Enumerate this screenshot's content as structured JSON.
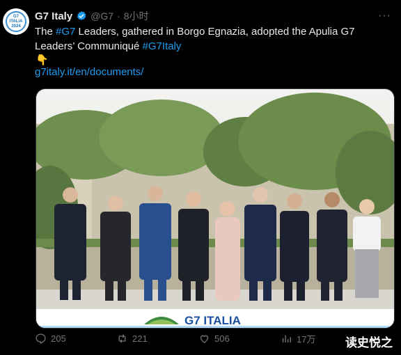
{
  "tweet": {
    "author_name": "G7 Italy",
    "handle": "@G7",
    "separator": "·",
    "time": "8小时",
    "avatar_text": "G7 ITALIA 2024",
    "text_prefix": "The ",
    "hashtag_1": "#G7",
    "text_middle": " Leaders, gathered in Borgo Egnazia, adopted the Apulia G7 Leaders’ Communiqué ",
    "hashtag_2": "#G7Italy",
    "emoji": "👇",
    "link": "g7italy.it/en/documents/",
    "more": "···"
  },
  "photo": {
    "banner_text": "G7 ITALIA"
  },
  "actions": {
    "replies": "205",
    "retweets": "221",
    "likes": "506",
    "views": "17万"
  },
  "watermark": "读史悦之",
  "colors": {
    "link": "#1d9bf0",
    "muted": "#71767b",
    "background": "#000000"
  }
}
